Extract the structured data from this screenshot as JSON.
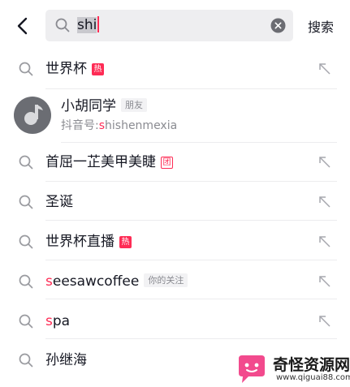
{
  "header": {
    "query_highlight": "shi",
    "query_rest": "",
    "search_button": "搜索"
  },
  "results": [
    {
      "kind": "query",
      "text": "世界杯",
      "badge": "热",
      "badge_style": "solid"
    },
    {
      "kind": "user",
      "name": "小胡同学",
      "tag": "朋友",
      "id_prefix": "抖音号:",
      "id_highlight": "s",
      "id_rest": "hishenmexia"
    },
    {
      "kind": "query",
      "text": "首屈一芷美甲美睫",
      "badge": "团",
      "badge_style": "outline"
    },
    {
      "kind": "query",
      "text": "圣诞"
    },
    {
      "kind": "query",
      "text": "世界杯直播",
      "badge": "热",
      "badge_style": "solid"
    },
    {
      "kind": "query",
      "text_highlight": "s",
      "text_rest": "eesawcoffee",
      "tag": "你的关注"
    },
    {
      "kind": "query",
      "text_highlight": "s",
      "text_rest": "pa"
    },
    {
      "kind": "query",
      "text": "孙继海"
    }
  ],
  "watermark": {
    "title": "奇怪资源网",
    "url": "www.qiguai88.com"
  },
  "colors": {
    "accent": "#fe2c55",
    "search_bg": "#eeeef0",
    "secondary_text": "#8a8b91"
  }
}
